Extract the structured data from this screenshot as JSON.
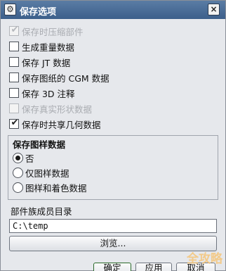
{
  "dialog": {
    "title": "保存选项",
    "title_icon": "gear-icon",
    "close_symbol": "×"
  },
  "options": [
    {
      "label": "保存时压缩部件",
      "checked": true,
      "disabled": true
    },
    {
      "label": "生成重量数据",
      "checked": false,
      "disabled": false
    },
    {
      "label": "保存 JT 数据",
      "checked": false,
      "disabled": false
    },
    {
      "label": "保存图纸的 CGM 数据",
      "checked": false,
      "disabled": false
    },
    {
      "label": "保存 3D 注释",
      "checked": false,
      "disabled": false
    },
    {
      "label": "保存真实形状数据",
      "checked": false,
      "disabled": true
    },
    {
      "label": "保存时共享几何数据",
      "checked": true,
      "disabled": false
    }
  ],
  "pattern_group": {
    "title": "保存图样数据",
    "options": [
      {
        "label": "否",
        "selected": true
      },
      {
        "label": "仅图样数据",
        "selected": false
      },
      {
        "label": "图样和着色数据",
        "selected": false
      }
    ]
  },
  "directory": {
    "label": "部件族成员目录",
    "value": "C:\\temp",
    "browse_label": "浏览..."
  },
  "buttons": {
    "ok": "确定",
    "apply": "应用",
    "cancel": "取消"
  },
  "watermark": "全攻略"
}
